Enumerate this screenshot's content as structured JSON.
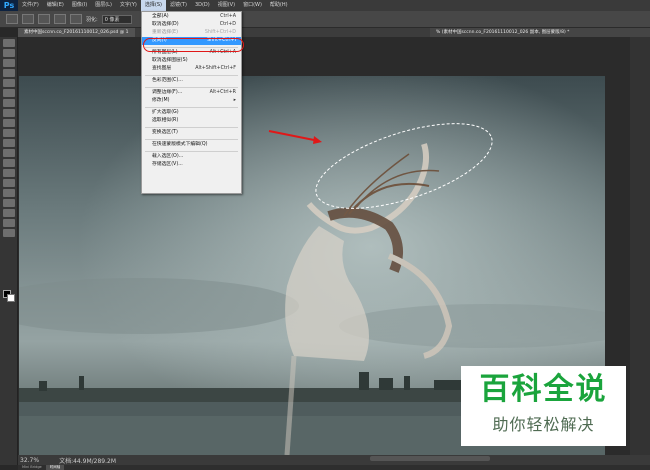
{
  "app": {
    "logo": "Ps"
  },
  "menubar": {
    "items": [
      "文件(F)",
      "编辑(E)",
      "图像(I)",
      "图层(L)",
      "文字(Y)",
      "选择(S)",
      "滤镜(T)",
      "3D(D)",
      "视图(V)",
      "窗口(W)",
      "帮助(H)"
    ],
    "active_index": 5
  },
  "options_bar": {
    "feather_label": "羽化:",
    "feather_value": "0 像素"
  },
  "tabs": {
    "left": "素材中国sccnn.co_F20161110012_026.psd @ 1",
    "right": "% (素材中国sccnn.co_F20161110012_026 副本, 图层蒙版/8) *"
  },
  "select_menu": {
    "items": [
      {
        "label": "全部(A)",
        "shortcut": "Ctrl+A",
        "state": "normal"
      },
      {
        "label": "取消选择(D)",
        "shortcut": "Ctrl+D",
        "state": "normal"
      },
      {
        "label": "重新选择(E)",
        "shortcut": "Shift+Ctrl+D",
        "state": "disabled"
      },
      {
        "label": "反向(I)",
        "shortcut": "Shift+Ctrl+I",
        "state": "highlight"
      },
      {
        "sep": true
      },
      {
        "label": "所有图层(L)",
        "shortcut": "Alt+Ctrl+A",
        "state": "normal"
      },
      {
        "label": "取消选择图层(S)",
        "shortcut": "",
        "state": "normal"
      },
      {
        "label": "查找图层",
        "shortcut": "Alt+Shift+Ctrl+F",
        "state": "normal"
      },
      {
        "sep": true
      },
      {
        "label": "色彩范围(C)...",
        "shortcut": "",
        "state": "normal"
      },
      {
        "sep": true
      },
      {
        "label": "调整边缘(F)...",
        "shortcut": "Alt+Ctrl+R",
        "state": "normal"
      },
      {
        "label": "修改(M)",
        "shortcut": "▸",
        "state": "normal"
      },
      {
        "sep": true
      },
      {
        "label": "扩大选取(G)",
        "shortcut": "",
        "state": "normal"
      },
      {
        "label": "选取相似(R)",
        "shortcut": "",
        "state": "normal"
      },
      {
        "sep": true
      },
      {
        "label": "变换选区(T)",
        "shortcut": "",
        "state": "normal"
      },
      {
        "sep": true
      },
      {
        "label": "在快速蒙版模式下编辑(Q)",
        "shortcut": "",
        "state": "normal"
      },
      {
        "sep": true
      },
      {
        "label": "载入选区(O)...",
        "shortcut": "",
        "state": "normal"
      },
      {
        "label": "存储选区(V)...",
        "shortcut": "",
        "state": "normal"
      }
    ]
  },
  "status": {
    "zoom": "32.7%",
    "doc_info": "文档:44.9M/289.2M"
  },
  "bottom_tabs": [
    "Mini Bridge",
    "时间轴"
  ],
  "watermark": {
    "title": "百科全说",
    "subtitle": "助你轻松解决"
  },
  "colors": {
    "highlight": "#3399ff",
    "annotation_red": "#e01818",
    "watermark_green": "#1aa43c"
  }
}
